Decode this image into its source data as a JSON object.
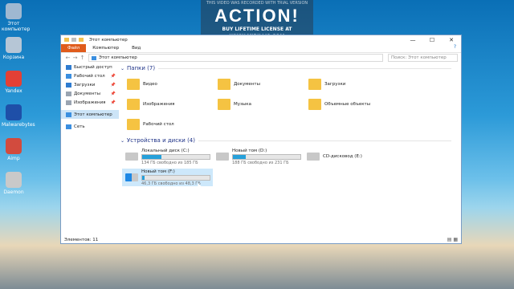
{
  "watermark": {
    "line1": "THIS VIDEO WAS RECORDED WITH TRIAL VERSION",
    "brand": "ACTION!",
    "line3": "BUY LIFETIME LICENSE AT WWW.MIRILLIS.COM"
  },
  "desktop": [
    {
      "label": "Этот компьютер",
      "color": "#9fb8d1"
    },
    {
      "label": "Корзина",
      "color": "#b6c6d6"
    },
    {
      "label": "Yandex",
      "color": "#e34035"
    },
    {
      "label": "Malwarebytes",
      "color": "#1e4fa8"
    },
    {
      "label": "Aimp",
      "color": "#d24b3e"
    },
    {
      "label": "Daemon",
      "color": "#c9c9c9"
    }
  ],
  "window": {
    "title": "Этот компьютер",
    "controls": [
      "—",
      "☐",
      "✕"
    ],
    "ribbon": {
      "file": "Файл",
      "tabs": [
        "Компьютер",
        "Вид"
      ],
      "help": "?"
    },
    "address": {
      "path": "Этот компьютер",
      "search_placeholder": "Поиск: Этот компьютер"
    },
    "nav": [
      {
        "label": "Быстрый доступ",
        "icon": "star",
        "color": "#2f7cd0",
        "pin": false
      },
      {
        "label": "Рабочий стол",
        "icon": "desktop",
        "color": "#3b8fe0",
        "pin": true
      },
      {
        "label": "Загрузки",
        "icon": "download",
        "color": "#2f7cd0",
        "pin": true
      },
      {
        "label": "Документы",
        "icon": "docs",
        "color": "#9aa4b1",
        "pin": true
      },
      {
        "label": "Изображения",
        "icon": "pictures",
        "color": "#9aa4b1",
        "pin": true
      },
      {
        "label": "Этот компьютер",
        "icon": "pc",
        "color": "#3b8fe0",
        "pin": false,
        "selected": true
      },
      {
        "label": "Сеть",
        "icon": "network",
        "color": "#3b8fe0",
        "pin": false
      }
    ],
    "folders_header": "Папки (7)",
    "folders": [
      "Видео",
      "Документы",
      "Загрузки",
      "Изображения",
      "Музыка",
      "Объемные объекты",
      "Рабочий стол"
    ],
    "drives_header": "Устройства и диски (4)",
    "drives": [
      {
        "name": "Локальный диск (C:)",
        "free": "134 ГБ свободно из 185 ГБ",
        "used": 0.28,
        "selected": false
      },
      {
        "name": "Новый том (D:)",
        "free": "188 ГБ свободно из 231 ГБ",
        "used": 0.19,
        "selected": false
      },
      {
        "name": "CD-дисковод (E:)",
        "free": "",
        "used": null,
        "selected": false
      },
      {
        "name": "Новый том (F:)",
        "free": "46,3 ГБ свободно из 48,3 ГБ",
        "used": 0.04,
        "selected": true
      }
    ],
    "status": "Элементов: 11",
    "view_icons": "▤ ▦"
  }
}
